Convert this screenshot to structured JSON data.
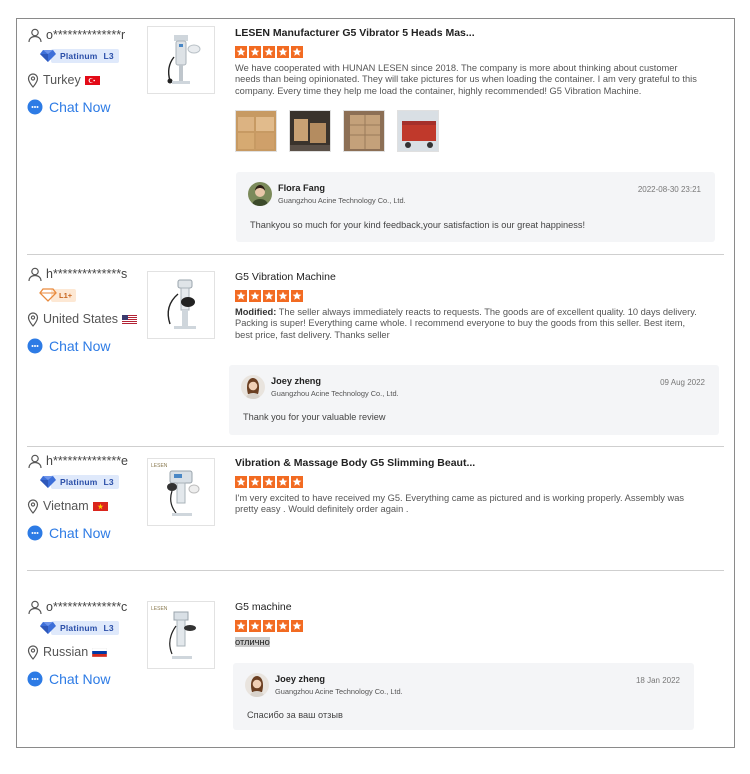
{
  "colors": {
    "accent": "#2d7be5",
    "star": "#f26b22",
    "platinum": "#3d6fd9",
    "l1": "#e98a3c"
  },
  "reviews": [
    {
      "buyer": "o**************r",
      "badge": "Platinum",
      "level": "L3",
      "country": "Turkey",
      "chat": "Chat Now",
      "title": "LESEN Manufacturer G5 Vibrator 5 Heads Mas...",
      "rating": 5,
      "text": "We have cooperated with HUNAN LESEN since 2018. The company is more about thinking about customer needs than being opinionated. They will take pictures for us when loading the container. I am very grateful to this company. Every time they help me load the container, highly recommended! G5 Vibration Machine.",
      "photo_count": 4,
      "reply": {
        "name": "Flora Fang",
        "company": "Guangzhou Acine Technology Co., Ltd.",
        "date": "2022-08-30 23:21",
        "text": "Thankyou so much for your kind feedback,your satisfaction is our great happiness!"
      }
    },
    {
      "buyer": "h**************s",
      "badge": "L1+",
      "country": "United States",
      "chat": "Chat Now",
      "title": "G5 Vibration Machine",
      "rating": 5,
      "modified_label": "Modified:",
      "text": "The seller always immediately reacts to requests. The goods are of excellent quality. 10 days delivery. Packing is super! Everything came whole. I recommend everyone to buy the goods from this seller. Best item, best price, fast delivery. Thanks seller",
      "reply": {
        "name": "Joey zheng",
        "company": "Guangzhou Acine Technology Co., Ltd.",
        "date": "09 Aug 2022",
        "text": "Thank you for your valuable review"
      }
    },
    {
      "buyer": "h**************e",
      "badge": "Platinum",
      "level": "L3",
      "country": "Vietnam",
      "chat": "Chat Now",
      "title": "Vibration & Massage Body G5 Slimming Beaut...",
      "rating": 5,
      "text": "I'm very excited to have received my G5. Everything came as pictured and is working properly. Assembly was pretty easy . Would definitely order again ."
    },
    {
      "buyer": "o**************c",
      "badge": "Platinum",
      "level": "L3",
      "country": "Russian",
      "chat": "Chat Now",
      "title": "G5 machine",
      "rating": 5,
      "text": "отлично",
      "reply": {
        "name": "Joey zheng",
        "company": "Guangzhou Acine Technology Co., Ltd.",
        "date": "18 Jan 2022",
        "text": "Спасибо за ваш отзыв"
      }
    }
  ]
}
